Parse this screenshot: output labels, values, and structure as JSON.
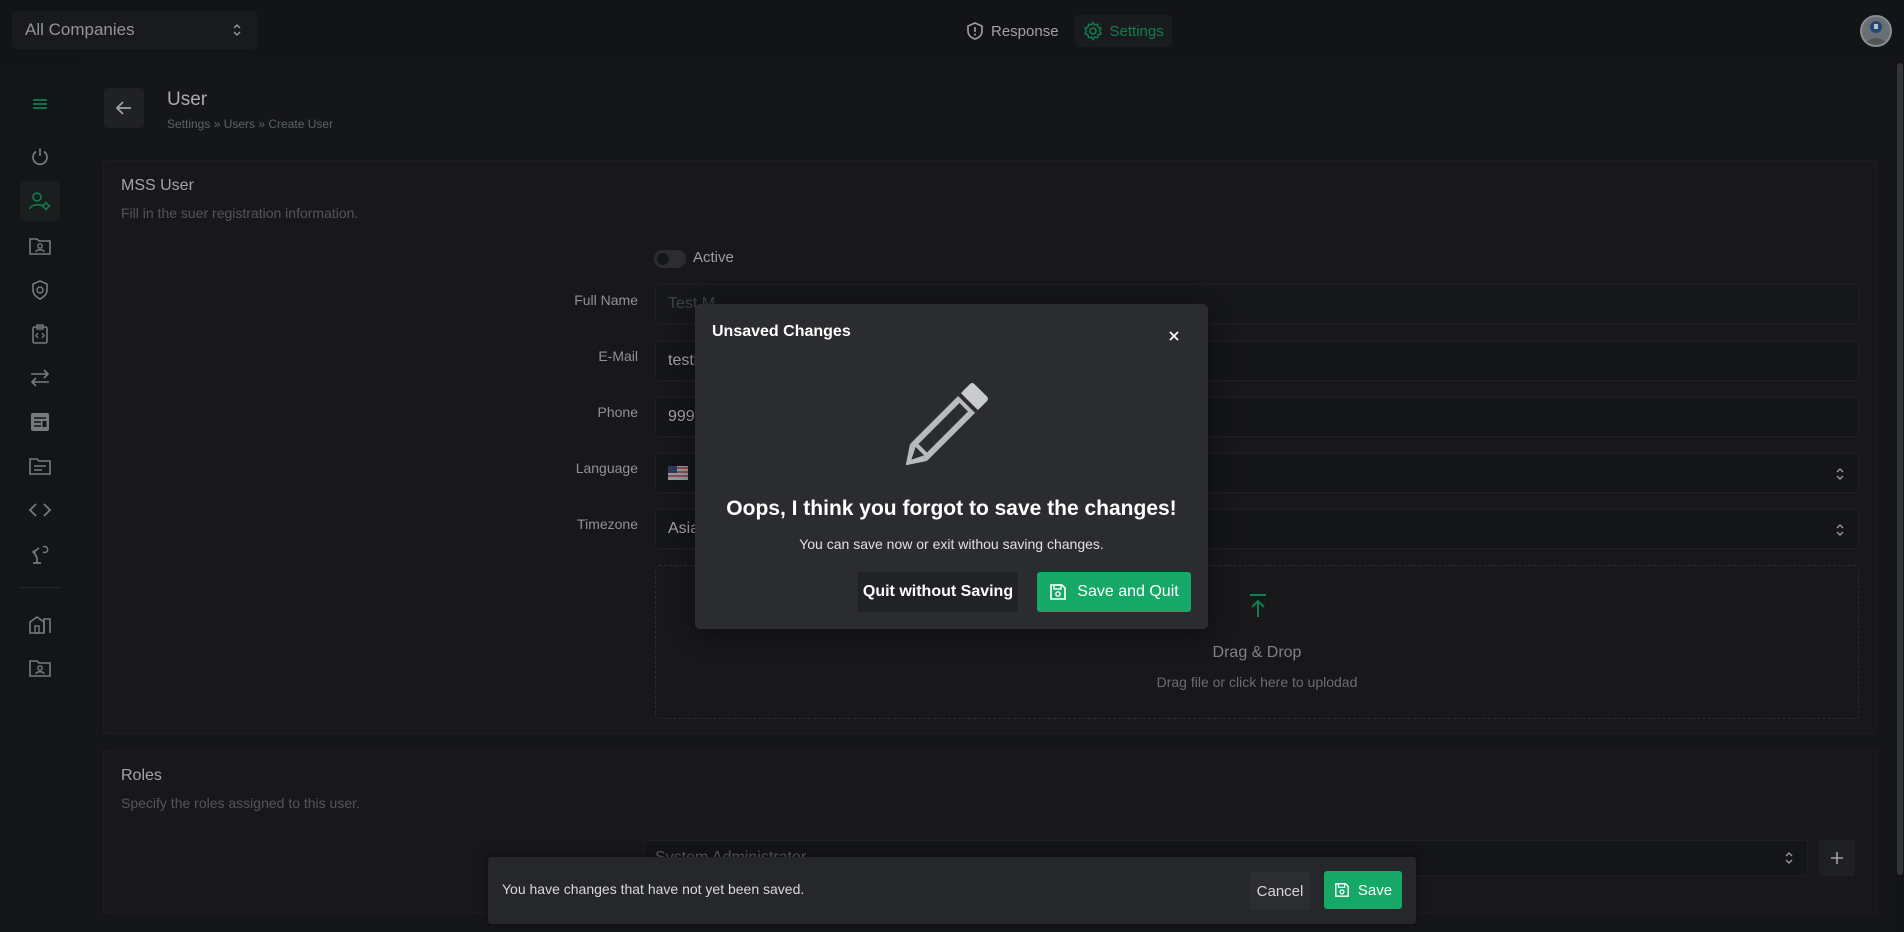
{
  "topbar": {
    "company_select": "All Companies",
    "nav": [
      {
        "label": "Response",
        "icon": "shield-alert-icon"
      },
      {
        "label": "Settings",
        "icon": "gear-icon",
        "active": true
      }
    ]
  },
  "sidebar": {
    "items": [
      {
        "icon": "menu-icon"
      },
      {
        "icon": "power-icon"
      },
      {
        "icon": "user-settings-icon",
        "active": true
      },
      {
        "icon": "contact-folder-icon"
      },
      {
        "icon": "shield-icon"
      },
      {
        "icon": "code-clipboard-icon"
      },
      {
        "icon": "transfer-arrows-icon"
      },
      {
        "icon": "newspaper-icon"
      },
      {
        "icon": "document-folder-icon"
      },
      {
        "icon": "code-brackets-icon"
      },
      {
        "icon": "robot-arm-icon"
      },
      {
        "icon": "buildings-icon"
      },
      {
        "icon": "user-folder-icon"
      }
    ]
  },
  "header": {
    "title": "User",
    "breadcrumb": "Settings » Users » Create User"
  },
  "mss_card": {
    "title": "MSS User",
    "subtitle": "Fill in the suer registration information.",
    "active_label": "Active",
    "labels": {
      "full_name": "Full Name",
      "email": "E-Mail",
      "phone": "Phone",
      "language": "Language",
      "timezone": "Timezone"
    },
    "values": {
      "full_name": "Test M",
      "email": "testl",
      "phone": "999(",
      "timezone": "Asia"
    },
    "dropzone": {
      "title": "Drag & Drop",
      "subtitle": "Drag file or click here to uplodad"
    }
  },
  "roles_card": {
    "title": "Roles",
    "subtitle": "Specify the roles assigned to this user.",
    "selected_role": "System Administrator"
  },
  "modal": {
    "title": "Unsaved Changes",
    "heading": "Oops, I think you forgot to save the changes!",
    "text": "You can save now or exit withou saving changes.",
    "quit_label": "Quit without Saving",
    "save_label": "Save and Quit"
  },
  "unsaved_bar": {
    "message": "You have changes that have not yet been saved.",
    "cancel_label": "Cancel",
    "save_label": "Save"
  },
  "colors": {
    "accent": "#16a867",
    "background": "#1d1e21",
    "modal_bg": "#2b2c30"
  }
}
